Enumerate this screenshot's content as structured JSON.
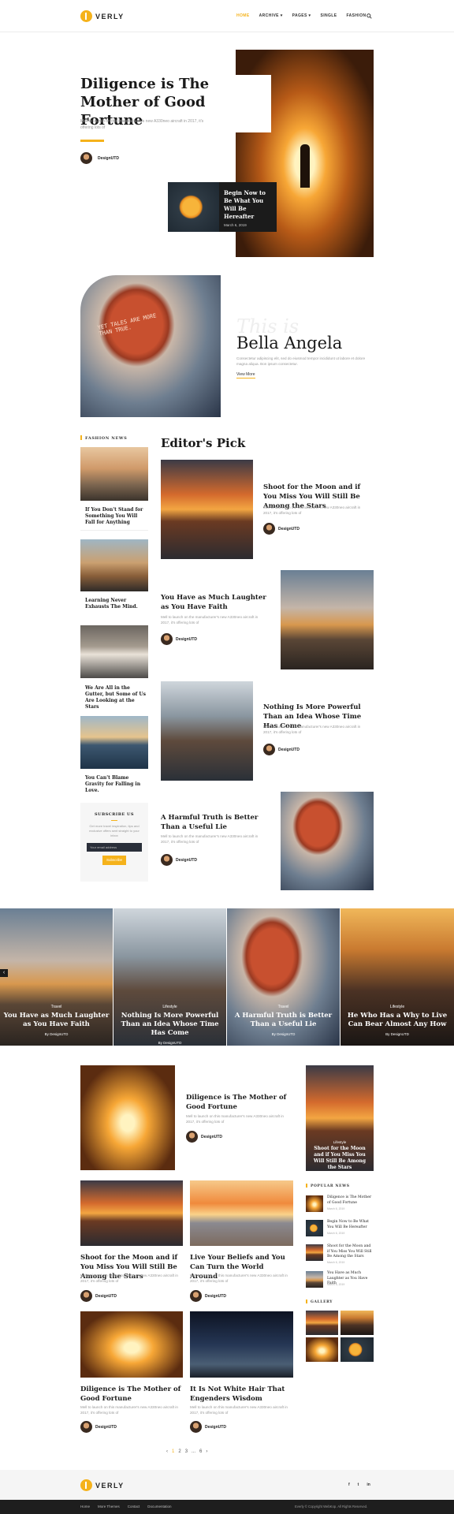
{
  "brand": {
    "name": "VERLY",
    "accent": "#f5b21b"
  },
  "nav": {
    "home": "HOME",
    "archive": "ARCHIVE ▾",
    "pages": "PAGES ▾",
    "single": "SINGLE",
    "fashion": "FASHION",
    "search_icon": "search-icon"
  },
  "hero": {
    "title": "Diligence is The Mother of Good Fortune",
    "excerpt": "Mell to launch on this manufacturer's new A330neo aircraft in 2017, it's offering lots of",
    "author": "DesignUTD",
    "card_title": "Begin Now to Be What You Will Be Hereafter",
    "card_date": "March 6, 2019"
  },
  "about": {
    "script": "This is",
    "name": "Bella Angela",
    "text": "Consectetur adipiscing elit, sed do eiusmod tempor incididunt ut labore et dolore magna aliqua. Bon ipsum consectetur.",
    "link": "View More"
  },
  "fashion": {
    "label": "FASHION NEWS",
    "items": [
      "If You Don't Stand for Something You Will Fall for Anything",
      "Learning Never Exhausts The Mind.",
      "We Are All in the Gutter, but Some of Us Are Looking at the Stars",
      "You Can't Blame Gravity for Falling in Love."
    ]
  },
  "subscribe": {
    "title": "SUBSCRIBE US",
    "text": "Get more travel inspiration, tips and exclusive offers sent straight to your inbox",
    "placeholder": "Your email address",
    "button": "Subscribe"
  },
  "editors": {
    "heading": "Editor's Pick",
    "author": "DesignUTD",
    "excerpt": "Mell to launch on the manufacturer's new A330neo aircraft in 2017, it's offering lots of",
    "posts": [
      "Shoot for the Moon and if You Miss You Will Still Be Among the Stars",
      "You Have as Much Laughter as You Have Faith",
      "Nothing Is More Powerful Than an Idea Whose Time Has Come",
      "A Harmful Truth is Better Than a Useful Lie"
    ]
  },
  "slider": {
    "author": "By DesignUTD",
    "slides": [
      {
        "cat": "Travel",
        "title": "You Have as Much Laughter as You Have Faith"
      },
      {
        "cat": "Lifestyle",
        "title": "Nothing Is More Powerful Than an Idea Whose Time Has Come"
      },
      {
        "cat": "Travel",
        "title": "A Harmful Truth is Better Than a Useful Lie"
      },
      {
        "cat": "Lifestyle",
        "title": "He Who Has a Why to Live Can Bear Almost Any How"
      }
    ]
  },
  "feed": {
    "author": "DesignUTD",
    "excerpt": "Mell to launch on this manufacturer's new A330neo aircraft in 2017, it's offering lots of",
    "featured": "Diligence is The Mother of Good Fortune",
    "grid": [
      "Shoot for the Moon and if You Miss You Will Still Be Among the Stars",
      "Live Your Beliefs and You Can Turn the World Around",
      "Diligence is The Mother of Good Fortune",
      "It Is Not White Hair That Engenders Wisdom"
    ],
    "side_card": {
      "cat": "Lifestyle",
      "title": "Shoot for the Moon and if You Miss You Will Still Be Among the Stars"
    }
  },
  "popular": {
    "label": "POPULAR NEWS",
    "items": [
      {
        "title": "Diligence is The Mother of Good Fortune",
        "date": "March 6, 2019"
      },
      {
        "title": "Begin Now to Be What You Will Be Hereafter",
        "date": "March 6, 2019"
      },
      {
        "title": "Shoot for the Moon and if You Miss You Will Still Be Among the Stars",
        "date": "March 6, 2019"
      },
      {
        "title": "You Have as Much Laughter as You Have Faith",
        "date": "March 6, 2019"
      }
    ]
  },
  "gallery": {
    "label": "GALLERY"
  },
  "pagination": {
    "prev": "‹",
    "p1": "1",
    "p2": "2",
    "p3": "3",
    "dots": "...",
    "p6": "6",
    "next": "›"
  },
  "footer": {
    "links": [
      "Home",
      "More Themes",
      "Contact",
      "Documentation"
    ],
    "copyright": "Everly © Copyright WebKop. All Rights Reserved.",
    "social": [
      "f",
      "t",
      "in"
    ]
  }
}
